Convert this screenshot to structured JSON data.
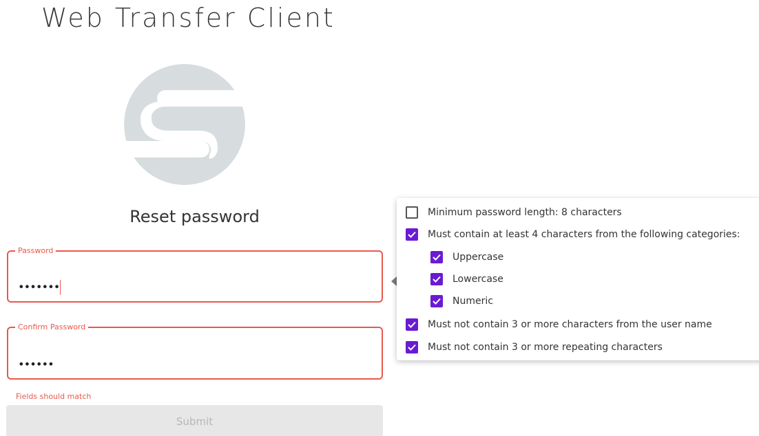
{
  "app": {
    "title": "Web Transfer Client"
  },
  "form": {
    "heading": "Reset password",
    "password": {
      "label": "Password",
      "value": "•••••••"
    },
    "confirm_password": {
      "label": "Confirm Password",
      "value": "••••••"
    },
    "error": "Fields should match",
    "submit_label": "Submit",
    "submit_enabled": false
  },
  "requirements": {
    "items": [
      {
        "label": "Minimum password length: 8 characters",
        "checked": false,
        "indent": 0
      },
      {
        "label": "Must contain at least 4 characters from the following categories:",
        "checked": true,
        "indent": 0
      },
      {
        "label": "Uppercase",
        "checked": true,
        "indent": 1
      },
      {
        "label": "Lowercase",
        "checked": true,
        "indent": 1
      },
      {
        "label": "Numeric",
        "checked": true,
        "indent": 1
      },
      {
        "label": "Must not contain 3 or more characters from the user name",
        "checked": true,
        "indent": 0
      },
      {
        "label": "Must not contain 3 or more repeating characters",
        "checked": true,
        "indent": 0
      }
    ]
  },
  "colors": {
    "error": "#e8584c",
    "checkbox_checked": "#6a1bd1",
    "logo": "#d7dcdf",
    "submit_disabled_bg": "#e7e7e7"
  },
  "icons": {
    "logo": "brand-s-logo-icon",
    "checkbox_checked": "checkbox-checked-icon",
    "checkbox_unchecked": "checkbox-unchecked-icon",
    "popover_arrow": "popover-arrow-icon"
  }
}
